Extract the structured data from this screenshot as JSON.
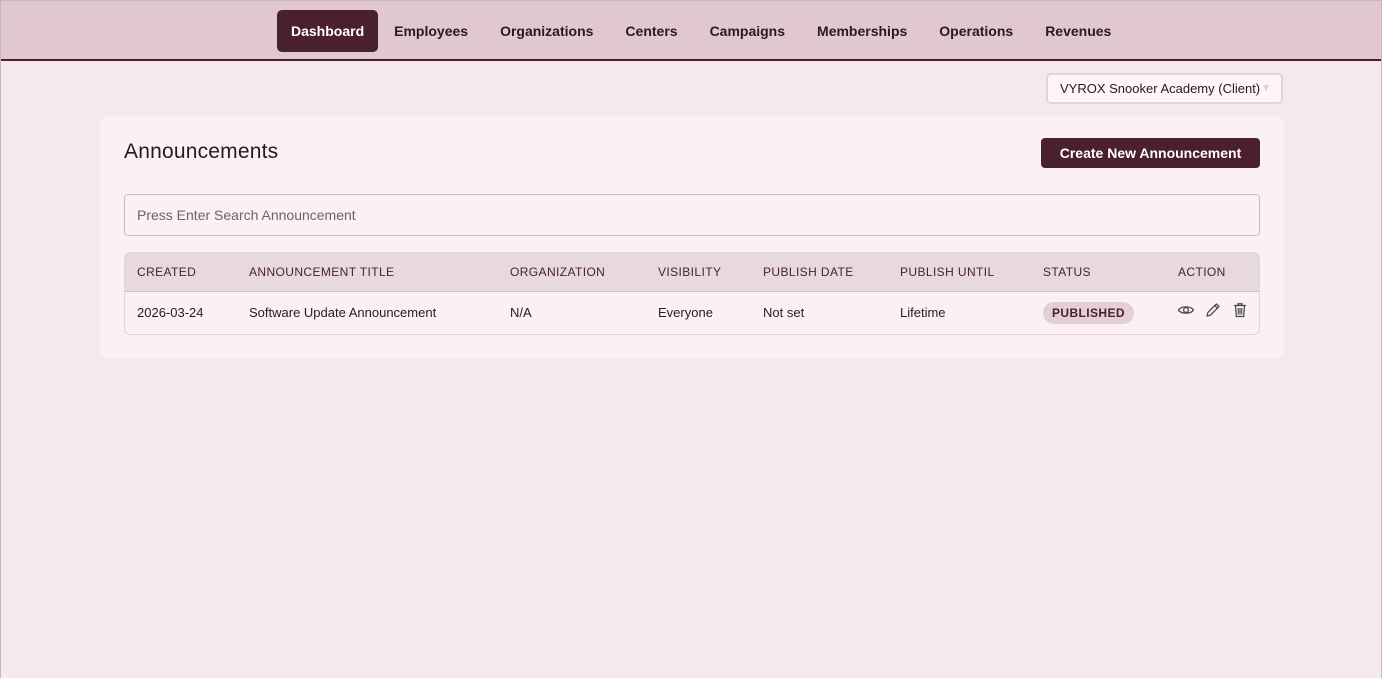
{
  "nav": {
    "items": [
      {
        "label": "Dashboard",
        "active": true
      },
      {
        "label": "Employees"
      },
      {
        "label": "Organizations"
      },
      {
        "label": "Centers"
      },
      {
        "label": "Campaigns"
      },
      {
        "label": "Memberships"
      },
      {
        "label": "Operations"
      },
      {
        "label": "Revenues"
      }
    ]
  },
  "client_selector": {
    "value": "VYROX Snooker Academy (Client)",
    "icon": "chevron-down-icon"
  },
  "page": {
    "title": "Announcements",
    "create_button_label": "Create New Announcement"
  },
  "search": {
    "placeholder": "Press Enter Search Announcement",
    "value": ""
  },
  "table": {
    "columns": [
      "CREATED",
      "ANNOUNCEMENT TITLE",
      "ORGANIZATION",
      "VISIBILITY",
      "PUBLISH DATE",
      "PUBLISH UNTIL",
      "STATUS",
      "ACTION"
    ],
    "rows": [
      {
        "created": "2026-03-24",
        "title": "Software Update Announcement",
        "organization": "N/A",
        "visibility": "Everyone",
        "publish_date": "Not set",
        "publish_until": "Lifetime",
        "status": "PUBLISHED",
        "actions": [
          "eye-icon",
          "pencil-icon",
          "trash-icon"
        ]
      }
    ]
  },
  "colors": {
    "accent": "#4a2030",
    "nav_bg": "#e0c8ce",
    "page_bg": "#f5e9ed",
    "card_bg": "#fbf1f4",
    "badge_bg": "#e3cfd4"
  }
}
